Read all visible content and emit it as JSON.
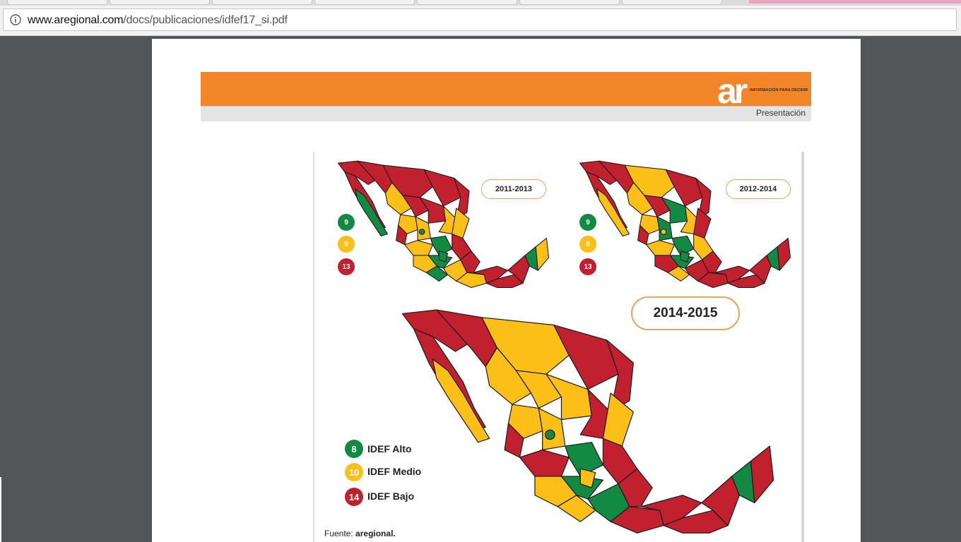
{
  "browser": {
    "url_host": "www.aregional.com",
    "url_path": "/docs/publicaciones/idfef17_si.pdf",
    "info_icon": "info-icon"
  },
  "header": {
    "logo_text": "ar",
    "logo_tagline": "INFORMACIÓN PARA DECIDIR",
    "section_label": "Presentación",
    "brand_color": "#f28527"
  },
  "colors": {
    "alto": "#138a43",
    "medio": "#fbbf17",
    "bajo": "#c1202e"
  },
  "maps": [
    {
      "period": "2011-2013",
      "counts": {
        "alto": "9",
        "medio": "9",
        "bajo": "13"
      }
    },
    {
      "period": "2012-2014",
      "counts": {
        "alto": "9",
        "medio": "9",
        "bajo": "13"
      }
    },
    {
      "period": "2014-2015",
      "counts": {
        "alto": "8",
        "medio": "10",
        "bajo": "14"
      },
      "legend": {
        "alto": "IDEF Alto",
        "medio": "IDEF Medio",
        "bajo": "IDEF Bajo"
      }
    }
  ],
  "source": {
    "prefix": "Fuente:",
    "name": "aregional."
  }
}
